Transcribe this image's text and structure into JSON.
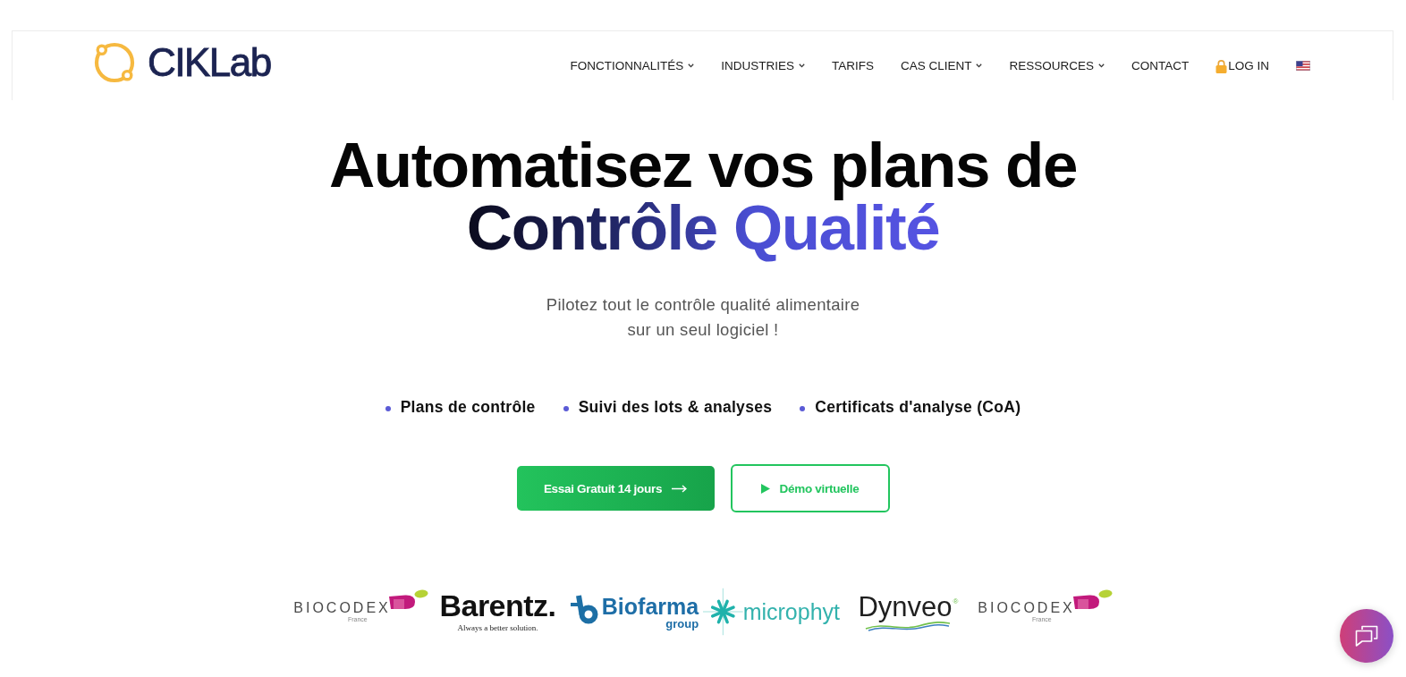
{
  "header": {
    "logo": {
      "wordmark": "CIKLab"
    },
    "nav": [
      {
        "label": "FONCTIONNALITÉS",
        "kind": "dropdown"
      },
      {
        "label": "INDUSTRIES",
        "kind": "dropdown"
      },
      {
        "label": "TARIFS",
        "kind": "link"
      },
      {
        "label": "CAS CLIENT",
        "kind": "dropdown"
      },
      {
        "label": "RESSOURCES",
        "kind": "dropdown"
      },
      {
        "label": "CONTACT",
        "kind": "link"
      },
      {
        "label": "LOG IN",
        "kind": "login"
      }
    ],
    "language_flag": true
  },
  "hero": {
    "title_lines": [
      {
        "text": "Automatisez vos plans de",
        "kind": "plain"
      },
      {
        "text": "Contrôle Qualité",
        "kind": "gradient"
      }
    ],
    "subtitle_lines": [
      "Pilotez tout le contrôle qualité alimentaire",
      "sur un seul logiciel !"
    ],
    "features": [
      "Plans de contrôle",
      "Suivi des lots & analyses",
      "Certificats d'analyse (CoA)"
    ],
    "buttons": [
      {
        "label": "Essai Gratuit 14 jours",
        "kind": "primary"
      },
      {
        "label": "Démo virtuelle",
        "kind": "outline"
      }
    ]
  },
  "client_logos": [
    {
      "kind": "biocodex",
      "wordmark": "BIOCODEX",
      "tagline": "France"
    },
    {
      "kind": "barentz",
      "wordmark": "Barentz.",
      "tagline": "Always a better solution."
    },
    {
      "kind": "biofarma",
      "wordmark": "Biofarma",
      "tagline": "group"
    },
    {
      "kind": "microphyt",
      "wordmark": "microphyt"
    },
    {
      "kind": "dynveo",
      "wordmark": "Dynveo",
      "mark": "®"
    },
    {
      "kind": "biocodex",
      "wordmark": "BIOCODEX",
      "tagline": "France"
    }
  ],
  "chat_button": true
}
